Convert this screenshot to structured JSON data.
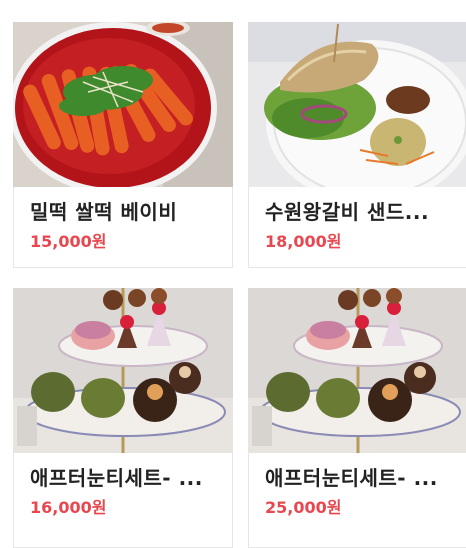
{
  "products": [
    {
      "name": "밀떡 쌀떡 베이비",
      "price": "15,000원",
      "image": "tteokbokki-photo"
    },
    {
      "name": "수원왕갈비 샌드...",
      "price": "18,000원",
      "image": "sandwich-photo"
    },
    {
      "name": "애프터눈티세트- ...",
      "price": "16,000원",
      "image": "afternoon-tea-photo"
    },
    {
      "name": "애프터눈티세트- ...",
      "price": "25,000원",
      "image": "afternoon-tea-photo"
    }
  ],
  "colors": {
    "price": "#e8474f",
    "name": "#222222",
    "border": "#e6e6e6"
  }
}
